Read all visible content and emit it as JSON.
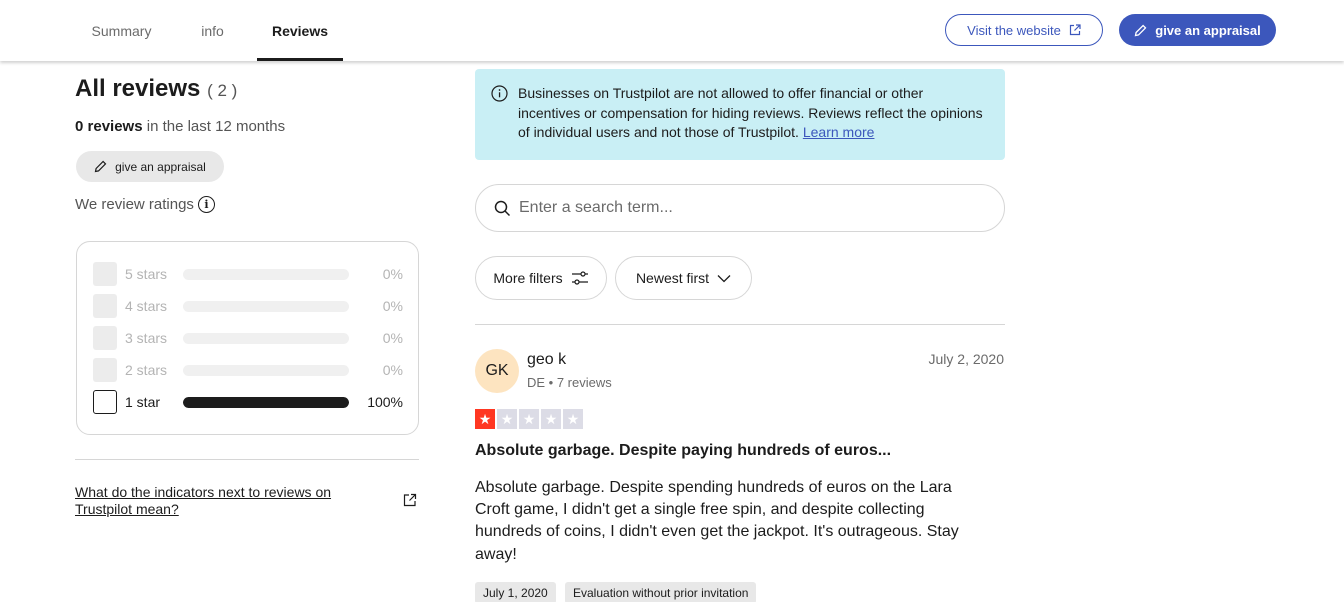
{
  "tabs": [
    {
      "label": "Summary",
      "active": false
    },
    {
      "label": "info",
      "active": false
    },
    {
      "label": "Reviews",
      "active": true
    }
  ],
  "header": {
    "visit_label": "Visit the website",
    "appraise_label": "give an appraisal"
  },
  "summary": {
    "title": "All reviews",
    "count": "( 2 )",
    "last12_count": "0",
    "last12_word": "reviews",
    "last12_suffix": "in the last 12 months",
    "appraise_label": "give an appraisal",
    "we_review_label": "We review ratings",
    "ratings": [
      {
        "label": "5 stars",
        "percent": "0%",
        "fill": 0
      },
      {
        "label": "4 stars",
        "percent": "0%",
        "fill": 0
      },
      {
        "label": "3 stars",
        "percent": "0%",
        "fill": 0
      },
      {
        "label": "2 stars",
        "percent": "0%",
        "fill": 0
      },
      {
        "label": "1 star",
        "percent": "100%",
        "fill": 1
      }
    ],
    "indicators_link": "What do the indicators next to reviews on Trustpilot mean?"
  },
  "notice": {
    "text": "Businesses on Trustpilot are not allowed to offer financial or other incentives or compensation for hiding reviews. Reviews reflect the opinions of individual users and not those of Trustpilot.",
    "link": "Learn more"
  },
  "search": {
    "placeholder": "Enter a search term..."
  },
  "filters": {
    "more_label": "More filters",
    "sort_label": "Newest first"
  },
  "review": {
    "initials": "GK",
    "name": "geo k",
    "meta": "DE • 7 reviews",
    "date": "July 2, 2020",
    "rating": 1,
    "title": "Absolute garbage. Despite paying hundreds of euros...",
    "body": "Absolute garbage. Despite spending hundreds of euros on the Lara Croft game, I didn't get a single free spin, and despite collecting hundreds of coins, I didn't even get the jackpot. It's outrageous. Stay away!",
    "experience_date": "July 1, 2020",
    "invitation_tag": "Evaluation without prior invitation"
  },
  "colors": {
    "brand_blue": "#3c57bc",
    "star_red": "#ff3722",
    "notice_bg": "#c9eff5",
    "avatar_bg": "#fde4c0"
  }
}
